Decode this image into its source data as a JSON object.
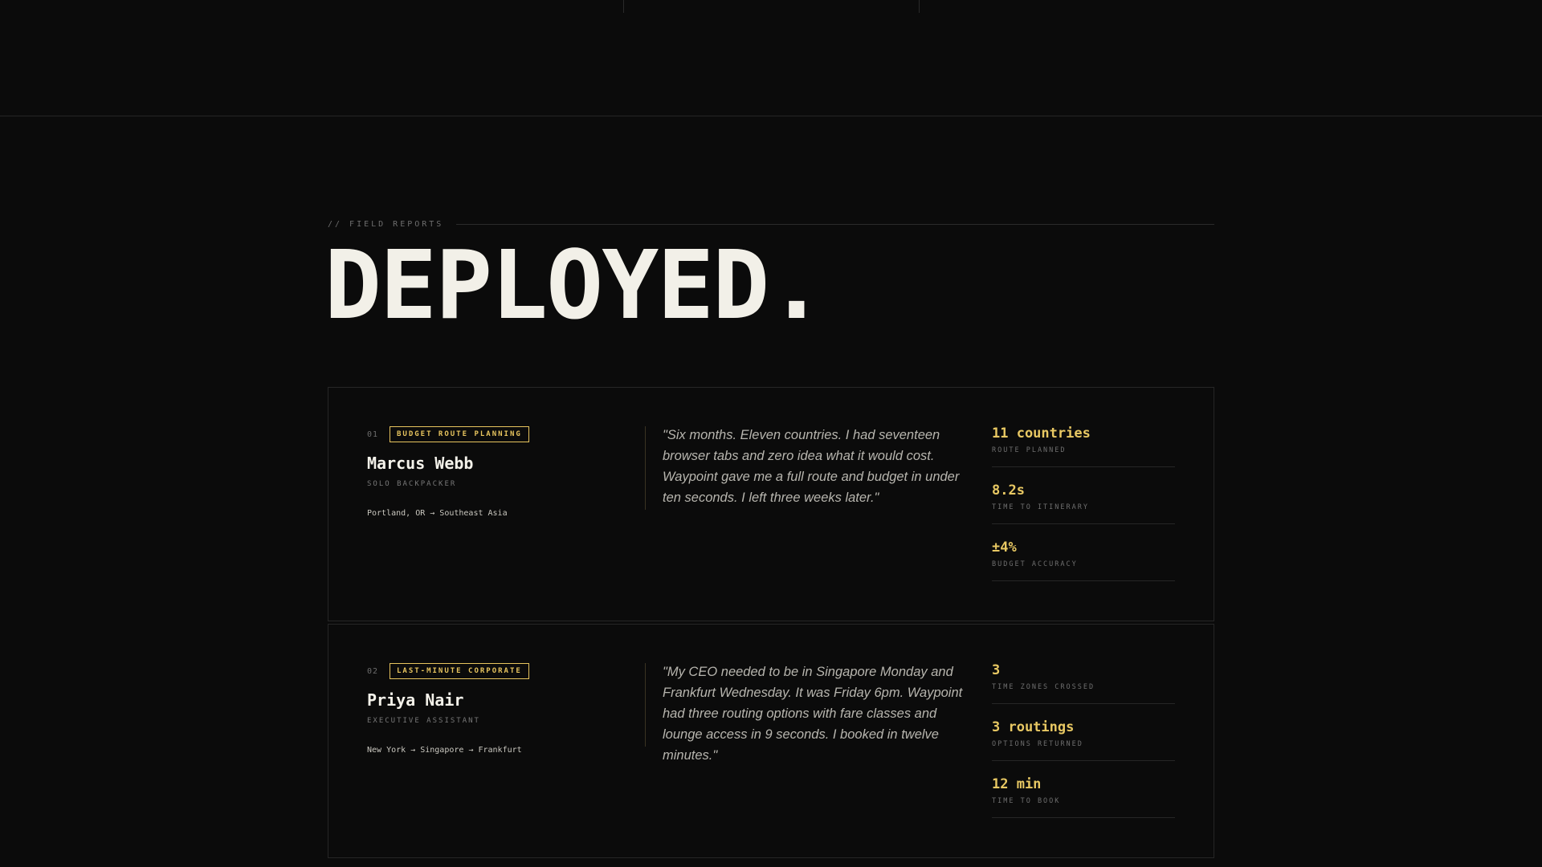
{
  "section": {
    "kicker": "// FIELD REPORTS",
    "headline": "DEPLOYED."
  },
  "cards": [
    {
      "num": "01",
      "tag": "BUDGET ROUTE PLANNING",
      "name": "Marcus Webb",
      "role": "SOLO BACKPACKER",
      "route": "Portland, OR → Southeast Asia",
      "quote": "\"Six months. Eleven countries. I had seventeen browser tabs and zero idea what it would cost. Waypoint gave me a full route and budget in under ten seconds. I left three weeks later.\"",
      "stats": [
        {
          "value": "11 countries",
          "label": "ROUTE PLANNED"
        },
        {
          "value": "8.2s",
          "label": "TIME TO ITINERARY"
        },
        {
          "value": "±4%",
          "label": "BUDGET ACCURACY"
        }
      ]
    },
    {
      "num": "02",
      "tag": "LAST-MINUTE CORPORATE",
      "name": "Priya Nair",
      "role": "EXECUTIVE ASSISTANT",
      "route": "New York → Singapore → Frankfurt",
      "quote": "\"My CEO needed to be in Singapore Monday and Frankfurt Wednesday. It was Friday 6pm. Waypoint had three routing options with fare classes and lounge access in 9 seconds. I booked in twelve minutes.\"",
      "stats": [
        {
          "value": "3",
          "label": "TIME ZONES CROSSED"
        },
        {
          "value": "3 routings",
          "label": "OPTIONS RETURNED"
        },
        {
          "value": "12 min",
          "label": "TIME TO BOOK"
        }
      ]
    }
  ]
}
